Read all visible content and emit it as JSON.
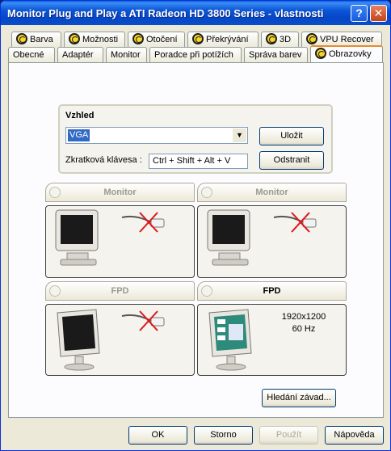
{
  "window": {
    "title": "Monitor Plug and Play a ATI Radeon HD 3800 Series - vlastnosti",
    "help_label": "?",
    "close_label": "✕"
  },
  "tabs_top": [
    {
      "label": "Barva",
      "icon": "ati-catalyst-icon"
    },
    {
      "label": "Možnosti",
      "icon": "ati-catalyst-icon"
    },
    {
      "label": "Otočení",
      "icon": "ati-catalyst-icon"
    },
    {
      "label": "Překrývání",
      "icon": "ati-catalyst-icon"
    },
    {
      "label": "3D",
      "icon": "ati-catalyst-icon"
    },
    {
      "label": "VPU Recover",
      "icon": "ati-catalyst-icon"
    }
  ],
  "tabs_bottom": [
    {
      "label": "Obecné"
    },
    {
      "label": "Adaptér"
    },
    {
      "label": "Monitor"
    },
    {
      "label": "Poradce při potížích"
    },
    {
      "label": "Správa barev"
    },
    {
      "label": "Obrazovky",
      "active": true
    }
  ],
  "scheme": {
    "title": "Vzhled",
    "selected": "VGA",
    "save_label": "Uložit",
    "hotkey_label": "Zkratková klávesa :",
    "hotkey_value": "Ctrl + Shift + Alt + V",
    "remove_label": "Odstranit"
  },
  "displays": [
    {
      "label": "Monitor",
      "enabled": false,
      "connected": false,
      "info": ""
    },
    {
      "label": "Monitor",
      "enabled": false,
      "connected": false,
      "info": ""
    },
    {
      "label": "FPD",
      "enabled": false,
      "connected": false,
      "info": ""
    },
    {
      "label": "FPD",
      "enabled": true,
      "connected": true,
      "resolution": "1920x1200",
      "refresh": "60 Hz"
    }
  ],
  "detect_label": "Hledání závad...",
  "footer": {
    "ok": "OK",
    "cancel": "Storno",
    "apply": "Použít",
    "help": "Nápověda"
  },
  "colors": {
    "titlebar": "#0a55d6",
    "dialog_bg": "#ece9d8",
    "active_tab_accent": "#e68b2c",
    "disconnected_mark": "#e0141a"
  }
}
